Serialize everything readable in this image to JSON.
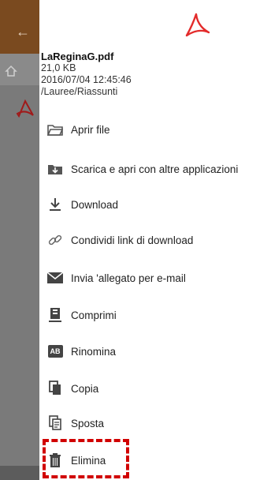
{
  "background_app": {
    "back_icon": "arrow-left-icon",
    "home_icon": "home-icon",
    "file_icon": "pdf-icon"
  },
  "file": {
    "name": "LaReginaG.pdf",
    "size": "21,0 KB",
    "date": "2016/07/04 12:45:46",
    "path": "/Lauree/Riassunti"
  },
  "menu": {
    "items": [
      {
        "label": "Aprir file",
        "icon": "folder-open-icon"
      },
      {
        "label": "Scarica e apri con altre applicazioni",
        "icon": "download-folder-icon"
      },
      {
        "label": "Download",
        "icon": "download-icon"
      },
      {
        "label": "Condividi link di download",
        "icon": "link-icon"
      },
      {
        "label": "Invia 'allegato per e-mail",
        "icon": "mail-icon"
      },
      {
        "label": "Comprimi",
        "icon": "compress-icon"
      },
      {
        "label": "Rinomina",
        "icon": "rename-icon"
      },
      {
        "label": "Copia",
        "icon": "copy-icon"
      },
      {
        "label": "Sposta",
        "icon": "move-icon"
      },
      {
        "label": "Elimina",
        "icon": "trash-icon"
      }
    ]
  },
  "icon_text": {
    "rename": "AB"
  },
  "colors": {
    "accent": "#d10000",
    "toolbar": "#7a4a1f"
  }
}
